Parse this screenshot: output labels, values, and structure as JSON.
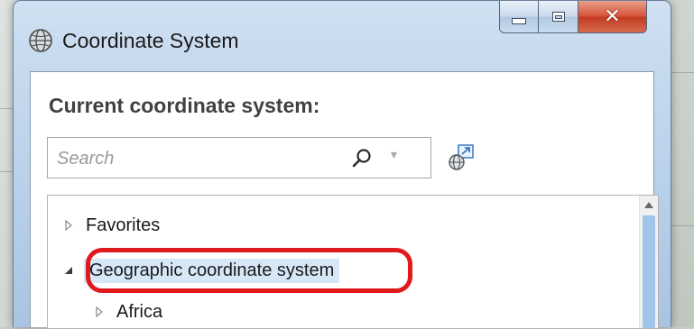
{
  "window": {
    "title": "Coordinate System",
    "caption_buttons": {
      "minimize": "minimize",
      "maximize": "maximize",
      "close": "close"
    }
  },
  "heading": "Current coordinate system:",
  "search": {
    "placeholder": "Search",
    "value": ""
  },
  "tree": {
    "items": [
      {
        "label": "Favorites",
        "expanded": false,
        "level": 0
      },
      {
        "label": "Geographic coordinate system",
        "expanded": true,
        "level": 0,
        "selected": true,
        "highlighted": true
      },
      {
        "label": "Africa",
        "expanded": false,
        "level": 1
      }
    ]
  },
  "colors": {
    "highlight_ring": "#e0191c",
    "selection": "#d6e8f7",
    "scroll_thumb": "#9fc6e8",
    "close_button": "#d7553a"
  },
  "icons": {
    "window": "globe-icon",
    "search": "search-icon",
    "tool": "globe-link-icon"
  }
}
